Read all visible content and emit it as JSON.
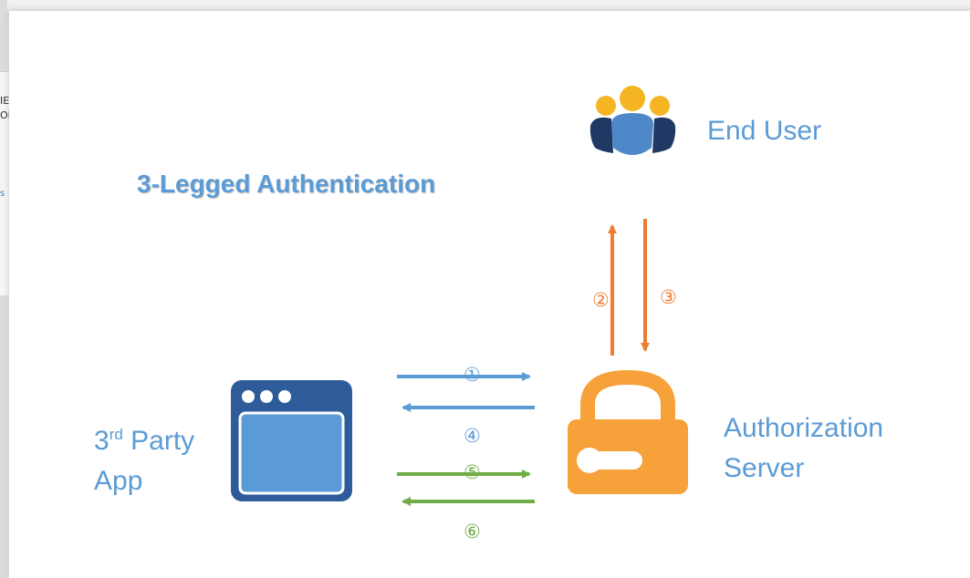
{
  "diagram": {
    "title": "3-Legged Authentication",
    "nodes": {
      "end_user": {
        "label": "End User",
        "icon": "users-group-icon"
      },
      "authorization_server": {
        "label_line1": "Authorization",
        "label_line2": "Server",
        "icon": "padlock-icon"
      },
      "third_party_app": {
        "label_prefix": "3",
        "label_superscript": "rd",
        "label_rest": " Party",
        "label_line2": "App",
        "icon": "app-window-icon"
      }
    },
    "steps": [
      {
        "id": "1",
        "glyph": "①",
        "from": "third_party_app",
        "to": "authorization_server",
        "color": "#5b9bd5"
      },
      {
        "id": "2",
        "glyph": "②",
        "from": "authorization_server",
        "to": "end_user",
        "color": "#ed7d31"
      },
      {
        "id": "3",
        "glyph": "③",
        "from": "end_user",
        "to": "authorization_server",
        "color": "#ed7d31"
      },
      {
        "id": "4",
        "glyph": "④",
        "from": "authorization_server",
        "to": "third_party_app",
        "color": "#5b9bd5"
      },
      {
        "id": "5",
        "glyph": "⑤",
        "from": "third_party_app",
        "to": "authorization_server",
        "color": "#70ad47"
      },
      {
        "id": "6",
        "glyph": "⑥",
        "from": "authorization_server",
        "to": "third_party_app",
        "color": "#70ad47"
      }
    ]
  },
  "colors": {
    "primary_blue": "#5b9bd5",
    "dark_blue": "#2e5c9a",
    "orange": "#ed7d31",
    "lock_orange": "#f7a13a",
    "green": "#70ad47",
    "user_gold": "#f5b523",
    "user_navy": "#1f3864"
  },
  "background_fragments": [
    "IE",
    "OI",
    "s"
  ]
}
